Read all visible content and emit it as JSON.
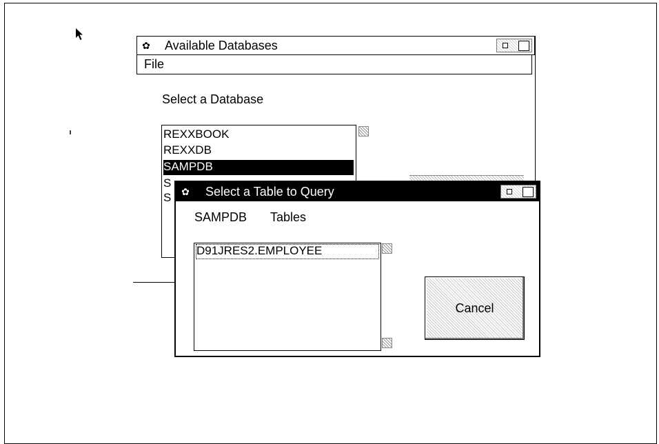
{
  "back_window": {
    "title": "Available Databases",
    "menu": [
      "File"
    ],
    "prompt": "Select a Database",
    "databases": [
      "REXXBOOK",
      "REXXDB",
      "SAMPDB",
      "S",
      "S"
    ],
    "selected_database": "SAMPDB"
  },
  "dialog": {
    "title": "Select a Table to Query",
    "database_label": "SAMPDB",
    "tables_label": "Tables",
    "tables": [
      "D91JRES2.EMPLOYEE"
    ],
    "cancel_label": "Cancel"
  },
  "icons": {
    "system_menu": "os2-system-menu-icon",
    "minimize": "minimize-icon",
    "maximize": "maximize-icon",
    "cursor": "mouse-pointer-icon"
  },
  "colors": {
    "selection_bg": "#000000",
    "selection_fg": "#ffffff",
    "window_bg": "#ffffff"
  }
}
